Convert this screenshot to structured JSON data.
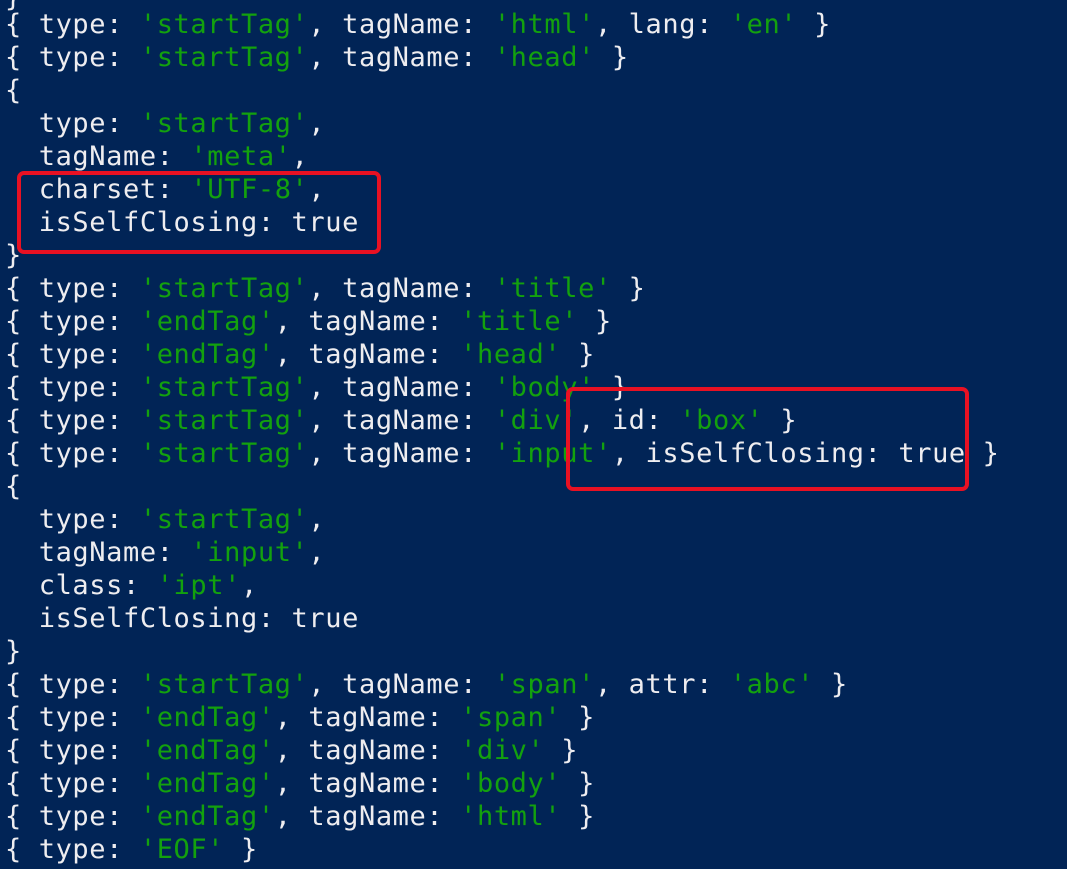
{
  "terminal": {
    "background": "#012456",
    "text_color": "#eeedf0",
    "string_color": "#13a10e",
    "highlight_color": "#e81123",
    "top_cut_text": "}",
    "lines": [
      [
        {
          "t": "{ type: ",
          "c": "w"
        },
        {
          "t": "'startTag'",
          "c": "g"
        },
        {
          "t": ", tagName: ",
          "c": "w"
        },
        {
          "t": "'html'",
          "c": "g"
        },
        {
          "t": ", lang: ",
          "c": "w"
        },
        {
          "t": "'en'",
          "c": "g"
        },
        {
          "t": " }",
          "c": "w"
        }
      ],
      [
        {
          "t": "{ type: ",
          "c": "w"
        },
        {
          "t": "'startTag'",
          "c": "g"
        },
        {
          "t": ", tagName: ",
          "c": "w"
        },
        {
          "t": "'head'",
          "c": "g"
        },
        {
          "t": " }",
          "c": "w"
        }
      ],
      [
        {
          "t": "{",
          "c": "w"
        }
      ],
      [
        {
          "t": "  type: ",
          "c": "w"
        },
        {
          "t": "'startTag'",
          "c": "g"
        },
        {
          "t": ",",
          "c": "w"
        }
      ],
      [
        {
          "t": "  tagName: ",
          "c": "w"
        },
        {
          "t": "'meta'",
          "c": "g"
        },
        {
          "t": ",",
          "c": "w"
        }
      ],
      [
        {
          "t": "  charset: ",
          "c": "w"
        },
        {
          "t": "'UTF-8'",
          "c": "g"
        },
        {
          "t": ",",
          "c": "w"
        }
      ],
      [
        {
          "t": "  isSelfClosing: true",
          "c": "w"
        }
      ],
      [
        {
          "t": "}",
          "c": "w"
        }
      ],
      [
        {
          "t": "{ type: ",
          "c": "w"
        },
        {
          "t": "'startTag'",
          "c": "g"
        },
        {
          "t": ", tagName: ",
          "c": "w"
        },
        {
          "t": "'title'",
          "c": "g"
        },
        {
          "t": " }",
          "c": "w"
        }
      ],
      [
        {
          "t": "{ type: ",
          "c": "w"
        },
        {
          "t": "'endTag'",
          "c": "g"
        },
        {
          "t": ", tagName: ",
          "c": "w"
        },
        {
          "t": "'title'",
          "c": "g"
        },
        {
          "t": " }",
          "c": "w"
        }
      ],
      [
        {
          "t": "{ type: ",
          "c": "w"
        },
        {
          "t": "'endTag'",
          "c": "g"
        },
        {
          "t": ", tagName: ",
          "c": "w"
        },
        {
          "t": "'head'",
          "c": "g"
        },
        {
          "t": " }",
          "c": "w"
        }
      ],
      [
        {
          "t": "{ type: ",
          "c": "w"
        },
        {
          "t": "'startTag'",
          "c": "g"
        },
        {
          "t": ", tagName: ",
          "c": "w"
        },
        {
          "t": "'body'",
          "c": "g"
        },
        {
          "t": " }",
          "c": "w"
        }
      ],
      [
        {
          "t": "{ type: ",
          "c": "w"
        },
        {
          "t": "'startTag'",
          "c": "g"
        },
        {
          "t": ", tagName: ",
          "c": "w"
        },
        {
          "t": "'div'",
          "c": "g"
        },
        {
          "t": ", id: ",
          "c": "w"
        },
        {
          "t": "'box'",
          "c": "g"
        },
        {
          "t": " }",
          "c": "w"
        }
      ],
      [
        {
          "t": "{ type: ",
          "c": "w"
        },
        {
          "t": "'startTag'",
          "c": "g"
        },
        {
          "t": ", tagName: ",
          "c": "w"
        },
        {
          "t": "'input'",
          "c": "g"
        },
        {
          "t": ", isSelfClosing: true }",
          "c": "w"
        }
      ],
      [
        {
          "t": "{",
          "c": "w"
        }
      ],
      [
        {
          "t": "  type: ",
          "c": "w"
        },
        {
          "t": "'startTag'",
          "c": "g"
        },
        {
          "t": ",",
          "c": "w"
        }
      ],
      [
        {
          "t": "  tagName: ",
          "c": "w"
        },
        {
          "t": "'input'",
          "c": "g"
        },
        {
          "t": ",",
          "c": "w"
        }
      ],
      [
        {
          "t": "  class: ",
          "c": "w"
        },
        {
          "t": "'ipt'",
          "c": "g"
        },
        {
          "t": ",",
          "c": "w"
        }
      ],
      [
        {
          "t": "  isSelfClosing: true",
          "c": "w"
        }
      ],
      [
        {
          "t": "}",
          "c": "w"
        }
      ],
      [
        {
          "t": "{ type: ",
          "c": "w"
        },
        {
          "t": "'startTag'",
          "c": "g"
        },
        {
          "t": ", tagName: ",
          "c": "w"
        },
        {
          "t": "'span'",
          "c": "g"
        },
        {
          "t": ", attr: ",
          "c": "w"
        },
        {
          "t": "'abc'",
          "c": "g"
        },
        {
          "t": " }",
          "c": "w"
        }
      ],
      [
        {
          "t": "{ type: ",
          "c": "w"
        },
        {
          "t": "'endTag'",
          "c": "g"
        },
        {
          "t": ", tagName: ",
          "c": "w"
        },
        {
          "t": "'span'",
          "c": "g"
        },
        {
          "t": " }",
          "c": "w"
        }
      ],
      [
        {
          "t": "{ type: ",
          "c": "w"
        },
        {
          "t": "'endTag'",
          "c": "g"
        },
        {
          "t": ", tagName: ",
          "c": "w"
        },
        {
          "t": "'div'",
          "c": "g"
        },
        {
          "t": " }",
          "c": "w"
        }
      ],
      [
        {
          "t": "{ type: ",
          "c": "w"
        },
        {
          "t": "'endTag'",
          "c": "g"
        },
        {
          "t": ", tagName: ",
          "c": "w"
        },
        {
          "t": "'body'",
          "c": "g"
        },
        {
          "t": " }",
          "c": "w"
        }
      ],
      [
        {
          "t": "{ type: ",
          "c": "w"
        },
        {
          "t": "'endTag'",
          "c": "g"
        },
        {
          "t": ", tagName: ",
          "c": "w"
        },
        {
          "t": "'html'",
          "c": "g"
        },
        {
          "t": " }",
          "c": "w"
        }
      ],
      [
        {
          "t": "{ type: ",
          "c": "w"
        },
        {
          "t": "'EOF'",
          "c": "g"
        },
        {
          "t": " }",
          "c": "w"
        }
      ]
    ]
  },
  "annotations": [
    {
      "label": "highlight-meta-attributes"
    },
    {
      "label": "highlight-div-input-attributes"
    }
  ]
}
